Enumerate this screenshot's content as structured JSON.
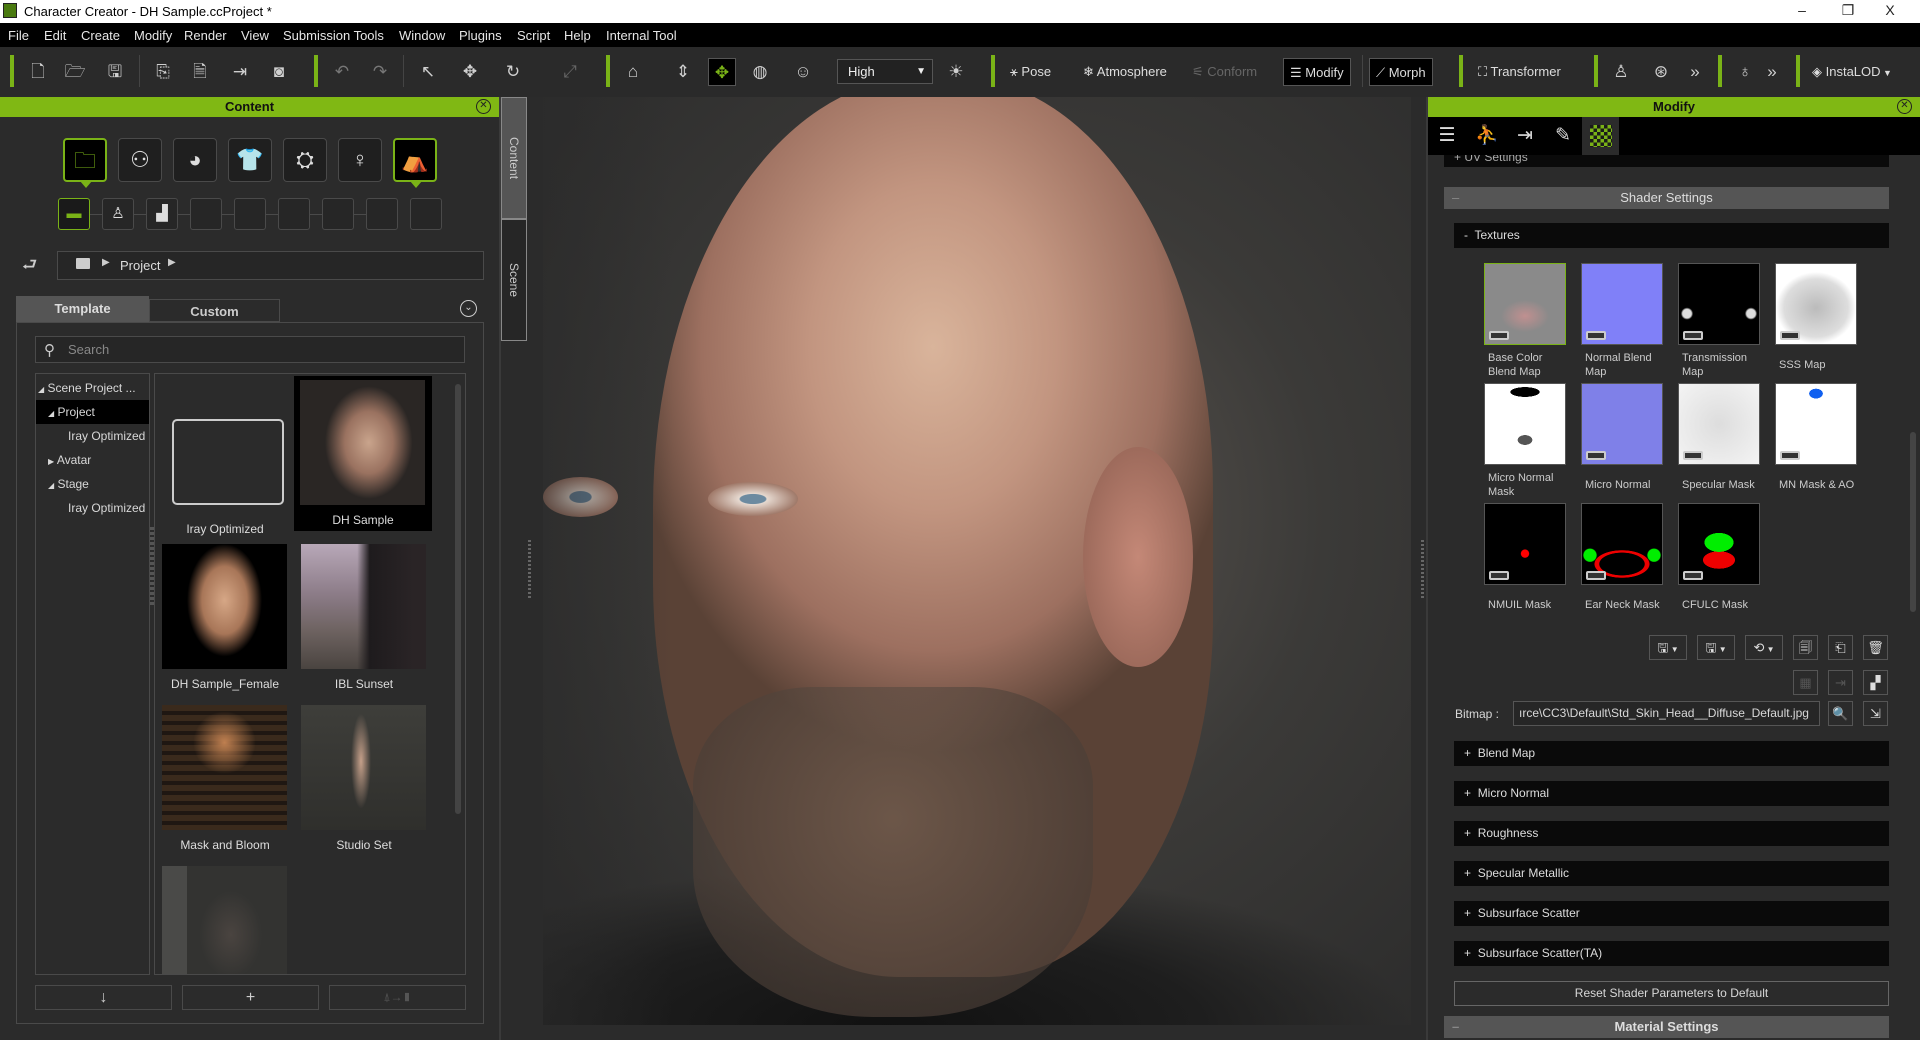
{
  "window": {
    "title": "Character Creator - DH Sample.ccProject *",
    "controls": {
      "minimize": "–",
      "restore": "❐",
      "close": "X"
    }
  },
  "menu": [
    "File",
    "Edit",
    "Create",
    "Modify",
    "Render",
    "View",
    "Submission Tools",
    "Window",
    "Plugins",
    "Script",
    "Help",
    "Internal Tool"
  ],
  "toolbar": {
    "quality": "High",
    "pose": "Pose",
    "atmosphere": "Atmosphere",
    "conform": "Conform",
    "modify": "Modify",
    "morph": "Morph",
    "transformer": "Transformer",
    "instalod": "InstaLOD",
    "more": "»"
  },
  "content_panel": {
    "title": "Content",
    "breadcrumb": [
      "Project"
    ],
    "tabs": [
      "Template",
      "Custom"
    ],
    "active_tab": "Template",
    "search_placeholder": "Search",
    "tree": [
      {
        "label": "Scene Project ...",
        "expander": "◢"
      },
      {
        "label": "Project",
        "expander": "◢",
        "selected": true
      },
      {
        "label": "Iray Optimized",
        "expander": ""
      },
      {
        "label": "Avatar",
        "expander": "▶"
      },
      {
        "label": "Stage",
        "expander": "◢"
      },
      {
        "label": "Iray Optimized",
        "expander": ""
      }
    ],
    "items": [
      "Iray Optimized",
      "DH Sample",
      "DH Sample_Female",
      "IBL Sunset",
      "Mask and Bloom",
      "Studio Set",
      ""
    ],
    "selected_item": "DH Sample",
    "bottom_buttons": [
      "↓",
      "+",
      "⍋→▮"
    ]
  },
  "side_tabs": [
    "Content",
    "Scene"
  ],
  "modify_panel": {
    "title": "Modify",
    "uv_settings": "UV Settings",
    "shader_settings": "Shader Settings",
    "textures_header": "Textures",
    "textures": [
      "Base Color Blend Map",
      "Normal Blend Map",
      "Transmission Map",
      "SSS Map",
      "Micro Normal Mask",
      "Micro Normal",
      "Specular Mask",
      "MN Mask & AO",
      "NMUIL Mask",
      "Ear Neck Mask",
      "CFULC Mask"
    ],
    "selected_texture": "Base Color Blend Map",
    "bitmap_label": "Bitmap :",
    "bitmap_value": "ırce\\CC3\\Default\\Std_Skin_Head__Diffuse_Default.jpg",
    "sections": [
      "Blend Map",
      "Micro Normal",
      "Roughness",
      "Specular Metallic",
      "Subsurface Scatter",
      "Subsurface Scatter(TA)"
    ],
    "reset_button": "Reset Shader Parameters to Default",
    "material_settings": "Material Settings"
  },
  "colors": {
    "accent": "#80b814",
    "panel": "#2b2b2b",
    "section": "#0a0a0a"
  }
}
